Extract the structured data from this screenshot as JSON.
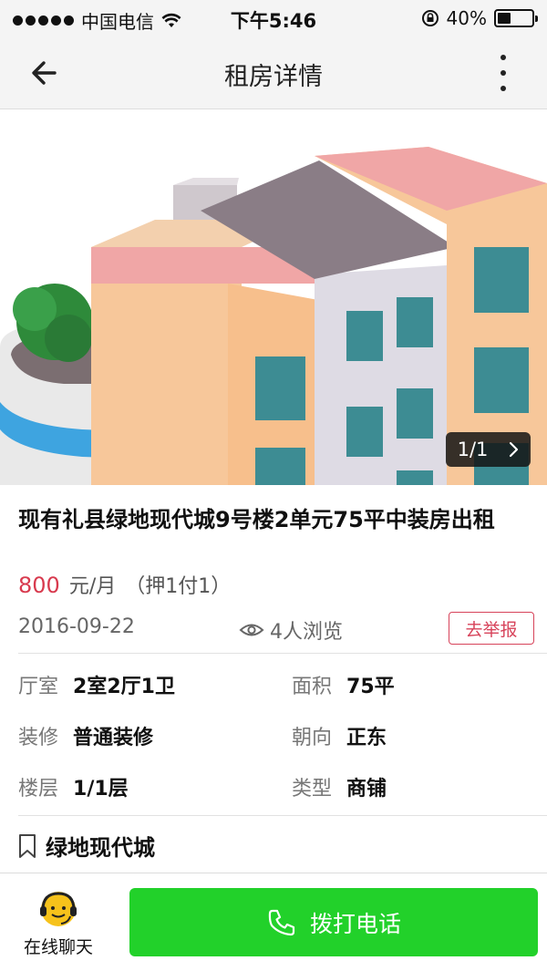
{
  "status_bar": {
    "carrier": "中国电信",
    "time": "下午5:46",
    "battery_text": "40%",
    "battery_level": 0.4
  },
  "nav": {
    "title": "租房详情"
  },
  "gallery": {
    "counter": "1/1"
  },
  "listing": {
    "title": "现有礼县绿地现代城9号楼2单元75平中装房出租",
    "price_amount": "800",
    "price_unit": "元/月",
    "deposit": "（押1付1）",
    "date": "2016-09-22",
    "views": "4人浏览",
    "report_label": "去举报"
  },
  "details": [
    {
      "label": "厅室",
      "value": "2室2厅1卫"
    },
    {
      "label": "面积",
      "value": "75平"
    },
    {
      "label": "装修",
      "value": "普通装修"
    },
    {
      "label": "朝向",
      "value": "正东"
    },
    {
      "label": "楼层",
      "value": "1/1层"
    },
    {
      "label": "类型",
      "value": "商铺"
    }
  ],
  "community": {
    "name": "绿地现代城"
  },
  "bottom": {
    "chat_label": "在线聊天",
    "call_label": "拨打电话"
  },
  "colors": {
    "accent_red": "#d83a4e",
    "call_green": "#22d12a"
  },
  "icons": {
    "back": "arrow-left-icon",
    "more": "more-vertical-icon",
    "eye": "eye-icon",
    "bookmark": "bookmark-icon",
    "chat": "chat-avatar-icon",
    "phone": "phone-icon"
  }
}
